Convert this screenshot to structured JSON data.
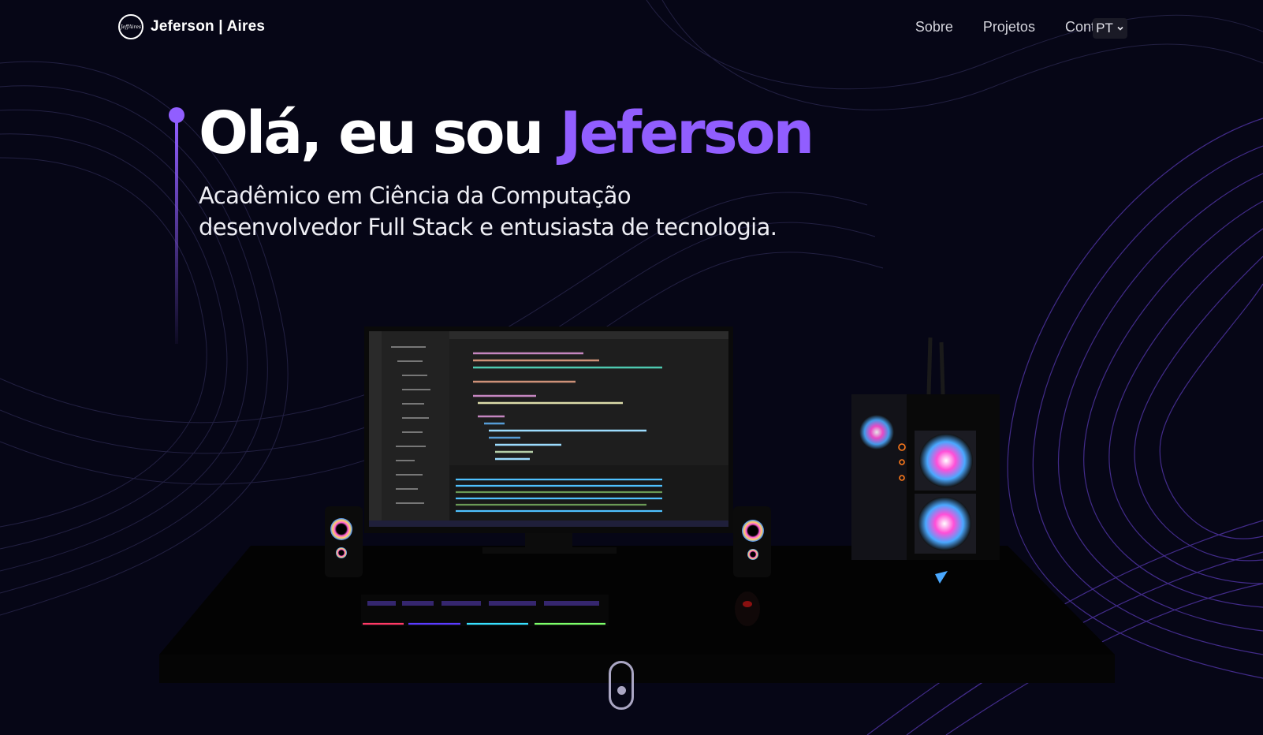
{
  "brand": {
    "logo_text": "JeffAires",
    "name": "Jeferson | Aires"
  },
  "nav": {
    "links": [
      "Sobre",
      "Projetos",
      "Contato"
    ],
    "language": "PT"
  },
  "hero": {
    "greeting": "Olá, eu sou",
    "name": "Jeferson",
    "subtitle_line1": "Acadêmico em Ciência da Computação",
    "subtitle_line2": "desenvolvedor Full Stack e entusiasta de tecnologia."
  },
  "colors": {
    "background": "#060616",
    "accent": "#915eff",
    "text": "#ffffff"
  },
  "icons": {
    "scroll": "mouse-scroll-icon",
    "language": "chevron-down-icon"
  }
}
